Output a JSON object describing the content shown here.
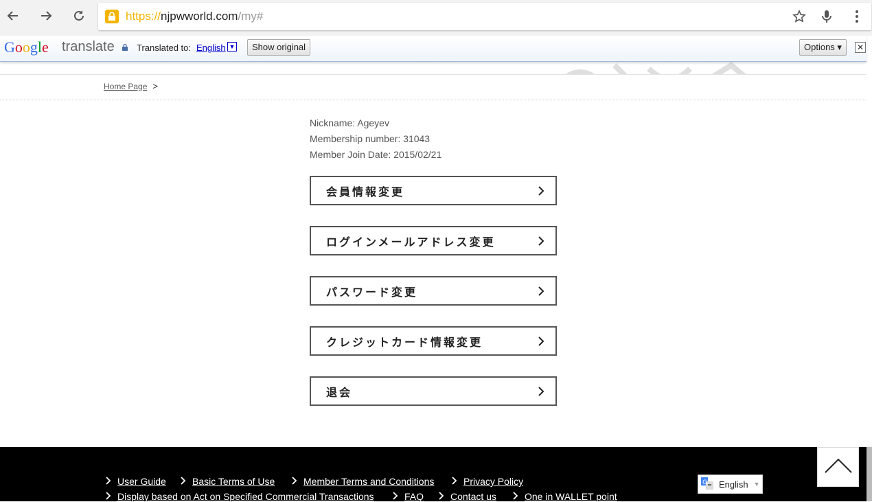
{
  "browser": {
    "url_scheme": "https://",
    "url_host": "njpwworld.com",
    "url_path": "/my#"
  },
  "translate_bar": {
    "logo_google": [
      "G",
      "o",
      "o",
      "g",
      "l",
      "e"
    ],
    "logo_translate": "translate",
    "translated_to_label": "Translated to:",
    "language": "English",
    "show_original": "Show original",
    "options": "Options ▾",
    "close": "✕"
  },
  "breadcrumb": {
    "home": "Home Page",
    "separator": ">"
  },
  "member": {
    "nickname": "Nickname: Ageyev",
    "membership_number": "Membership number: 31043",
    "join_date": "Member Join Date: 2015/02/21"
  },
  "menu": [
    {
      "label": "会員情報変更"
    },
    {
      "label": "ログインメールアドレス変更"
    },
    {
      "label": "パスワード変更"
    },
    {
      "label": "クレジットカード情報変更"
    },
    {
      "label": "退会"
    }
  ],
  "footer": {
    "links_row1": [
      "User Guide",
      "Basic Terms of Use",
      "Member Terms and Conditions",
      "Privacy Policy"
    ],
    "links_row2": [
      "Display based on Act on Specified Commercial Transactions",
      "FAQ",
      "Contact us",
      "One in WALLET point"
    ],
    "language_selector": "English"
  },
  "colors": {
    "translate_link": "#0000cc",
    "lock_badge": "#f4b400",
    "footer_bg": "#000000"
  }
}
